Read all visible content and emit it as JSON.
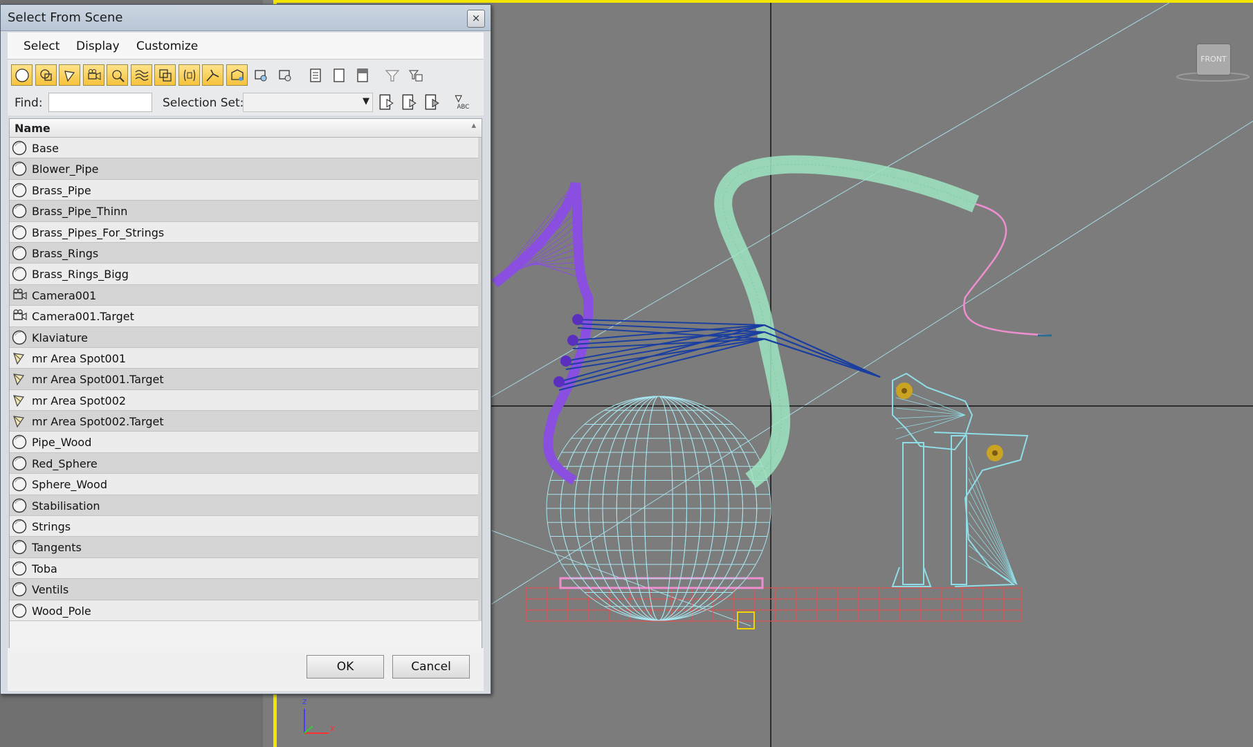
{
  "dialog": {
    "title": "Select From Scene",
    "close_glyph": "×",
    "menu": [
      "Select",
      "Display",
      "Customize"
    ],
    "find_label": "Find:",
    "find_value": "",
    "selection_set_label": "Selection Set:",
    "selection_set_value": "",
    "column_name": "Name",
    "ok_label": "OK",
    "cancel_label": "Cancel",
    "toolbar_icons": [
      "geometry-filter-icon",
      "shapes-filter-icon",
      "lights-filter-icon",
      "cameras-filter-icon",
      "helpers-filter-icon",
      "space-warps-filter-icon",
      "groups-filter-icon",
      "xrefs-filter-icon",
      "bones-filter-icon",
      "containers-filter-icon",
      "frozen-filter-icon",
      "hidden-filter-icon",
      "display-all-icon",
      "display-none-icon",
      "invert-display-icon",
      "filter-icon",
      "filter-settings-icon"
    ],
    "selection_set_icons": [
      "select-set-add-icon",
      "select-set-remove-icon",
      "select-set-highlight-icon",
      "select-by-name-icon"
    ],
    "objects": [
      {
        "name": "Base",
        "type": "geometry"
      },
      {
        "name": "Blower_Pipe",
        "type": "geometry"
      },
      {
        "name": "Brass_Pipe",
        "type": "geometry"
      },
      {
        "name": "Brass_Pipe_Thinn",
        "type": "geometry"
      },
      {
        "name": "Brass_Pipes_For_Strings",
        "type": "geometry"
      },
      {
        "name": "Brass_Rings",
        "type": "geometry"
      },
      {
        "name": "Brass_Rings_Bigg",
        "type": "geometry"
      },
      {
        "name": "Camera001",
        "type": "camera"
      },
      {
        "name": "Camera001.Target",
        "type": "camera"
      },
      {
        "name": "Klaviature",
        "type": "geometry"
      },
      {
        "name": "mr Area Spot001",
        "type": "light"
      },
      {
        "name": "mr Area Spot001.Target",
        "type": "light"
      },
      {
        "name": "mr Area Spot002",
        "type": "light"
      },
      {
        "name": "mr Area Spot002.Target",
        "type": "light"
      },
      {
        "name": "Pipe_Wood",
        "type": "geometry"
      },
      {
        "name": "Red_Sphere",
        "type": "geometry"
      },
      {
        "name": "Sphere_Wood",
        "type": "geometry"
      },
      {
        "name": "Stabilisation",
        "type": "geometry"
      },
      {
        "name": "Strings",
        "type": "geometry"
      },
      {
        "name": "Tangents",
        "type": "geometry"
      },
      {
        "name": "Toba",
        "type": "geometry"
      },
      {
        "name": "Ventils",
        "type": "geometry"
      },
      {
        "name": "Wood_Pole",
        "type": "geometry"
      }
    ]
  },
  "viewport": {
    "view_label": "FRONT",
    "axis_z": "z",
    "axis_x": "x",
    "colors": {
      "background": "#7c7c7c",
      "active_border": "#f2e600",
      "base_wire": "#e05050",
      "sphere_wire": "#a6e6ef",
      "pipe_wire": "#9fe6c2",
      "horn_wire": "#8a4fe0",
      "strings": "#1a3fa0",
      "light_wire": "#ef8fd0",
      "brass": "#c9a321"
    }
  }
}
